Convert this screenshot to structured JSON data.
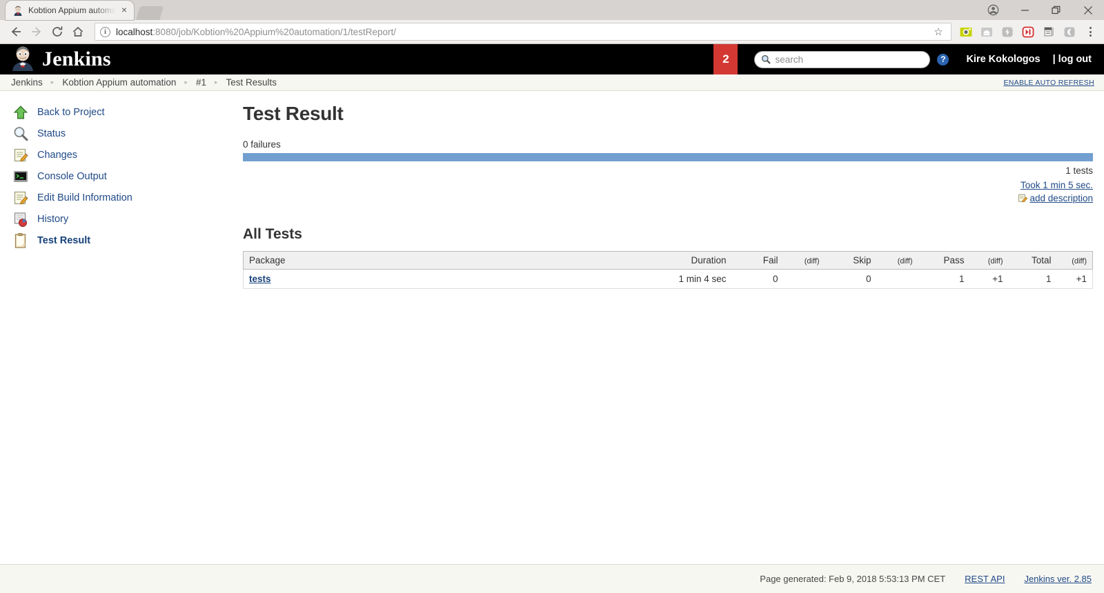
{
  "browser": {
    "tab": {
      "title": "Kobtion Appium automa",
      "favicon_name": "jenkins-butler-favicon",
      "close_label": "×"
    },
    "newtab_label": "+",
    "window_controls": {
      "profile": "profile-icon",
      "minimize": "—",
      "maximize": "❐",
      "close": "✕"
    },
    "nav": {
      "back": "←",
      "forward": "→",
      "reload": "⟳",
      "home": "⌂"
    },
    "url": {
      "info_glyph": "i",
      "host": "localhost",
      "rest": ":8080/job/Kobtion%20Appium%20automation/1/testReport/",
      "star": "☆"
    },
    "extensions": [
      "camera-extension-icon",
      "android-extension-icon",
      "lightning-extension-icon",
      "fastforward-extension-icon",
      "clipboard-extension-icon",
      "moon-extension-icon"
    ],
    "menu": "chrome-menu-icon"
  },
  "header": {
    "logo_text": "Jenkins",
    "logo_icon": "jenkins-butler-logo",
    "badge_count": "2",
    "search": {
      "placeholder": "search",
      "value": "",
      "icon": "search-icon"
    },
    "help_label": "?",
    "user_name": "Kire Kokologos",
    "logout_label": "| log out"
  },
  "breadcrumb": {
    "items": [
      "Jenkins",
      "Kobtion Appium automation",
      "#1",
      "Test Results"
    ],
    "separator": "▸",
    "auto_refresh_label": "ENABLE AUTO REFRESH"
  },
  "sidebar": {
    "items": [
      {
        "label": "Back to Project",
        "icon": "up-arrow-icon",
        "active": false
      },
      {
        "label": "Status",
        "icon": "magnifier-icon",
        "active": false
      },
      {
        "label": "Changes",
        "icon": "notepad-pencil-icon",
        "active": false
      },
      {
        "label": "Console Output",
        "icon": "terminal-icon",
        "active": false
      },
      {
        "label": "Edit Build Information",
        "icon": "notepad-pencil-icon",
        "active": false
      },
      {
        "label": "History",
        "icon": "history-chart-icon",
        "active": false
      },
      {
        "label": "Test Result",
        "icon": "clipboard-icon",
        "active": true
      }
    ]
  },
  "main": {
    "title": "Test Result",
    "failures_text": "0 failures",
    "progress_percent": 100,
    "progress_color": "#729fcf",
    "tests_count_text": "1 tests",
    "took_label": "Took 1 min 5 sec.",
    "add_description_label": "add description",
    "add_description_icon": "edit-notepad-icon",
    "all_tests_title": "All Tests",
    "table": {
      "headers": {
        "package": "Package",
        "duration": "Duration",
        "fail": "Fail",
        "skip": "Skip",
        "pass": "Pass",
        "total": "Total",
        "diff": "(diff)"
      },
      "rows": [
        {
          "package": "tests",
          "duration": "1 min 4 sec",
          "fail": "0",
          "fail_diff": "",
          "skip": "0",
          "skip_diff": "",
          "pass": "1",
          "pass_diff": "+1",
          "total": "1",
          "total_diff": "+1"
        }
      ]
    }
  },
  "footer": {
    "generated_text": "Page generated: Feb 9, 2018 5:53:13 PM CET",
    "rest_api_label": "REST API",
    "version_label": "Jenkins ver. 2.85"
  }
}
